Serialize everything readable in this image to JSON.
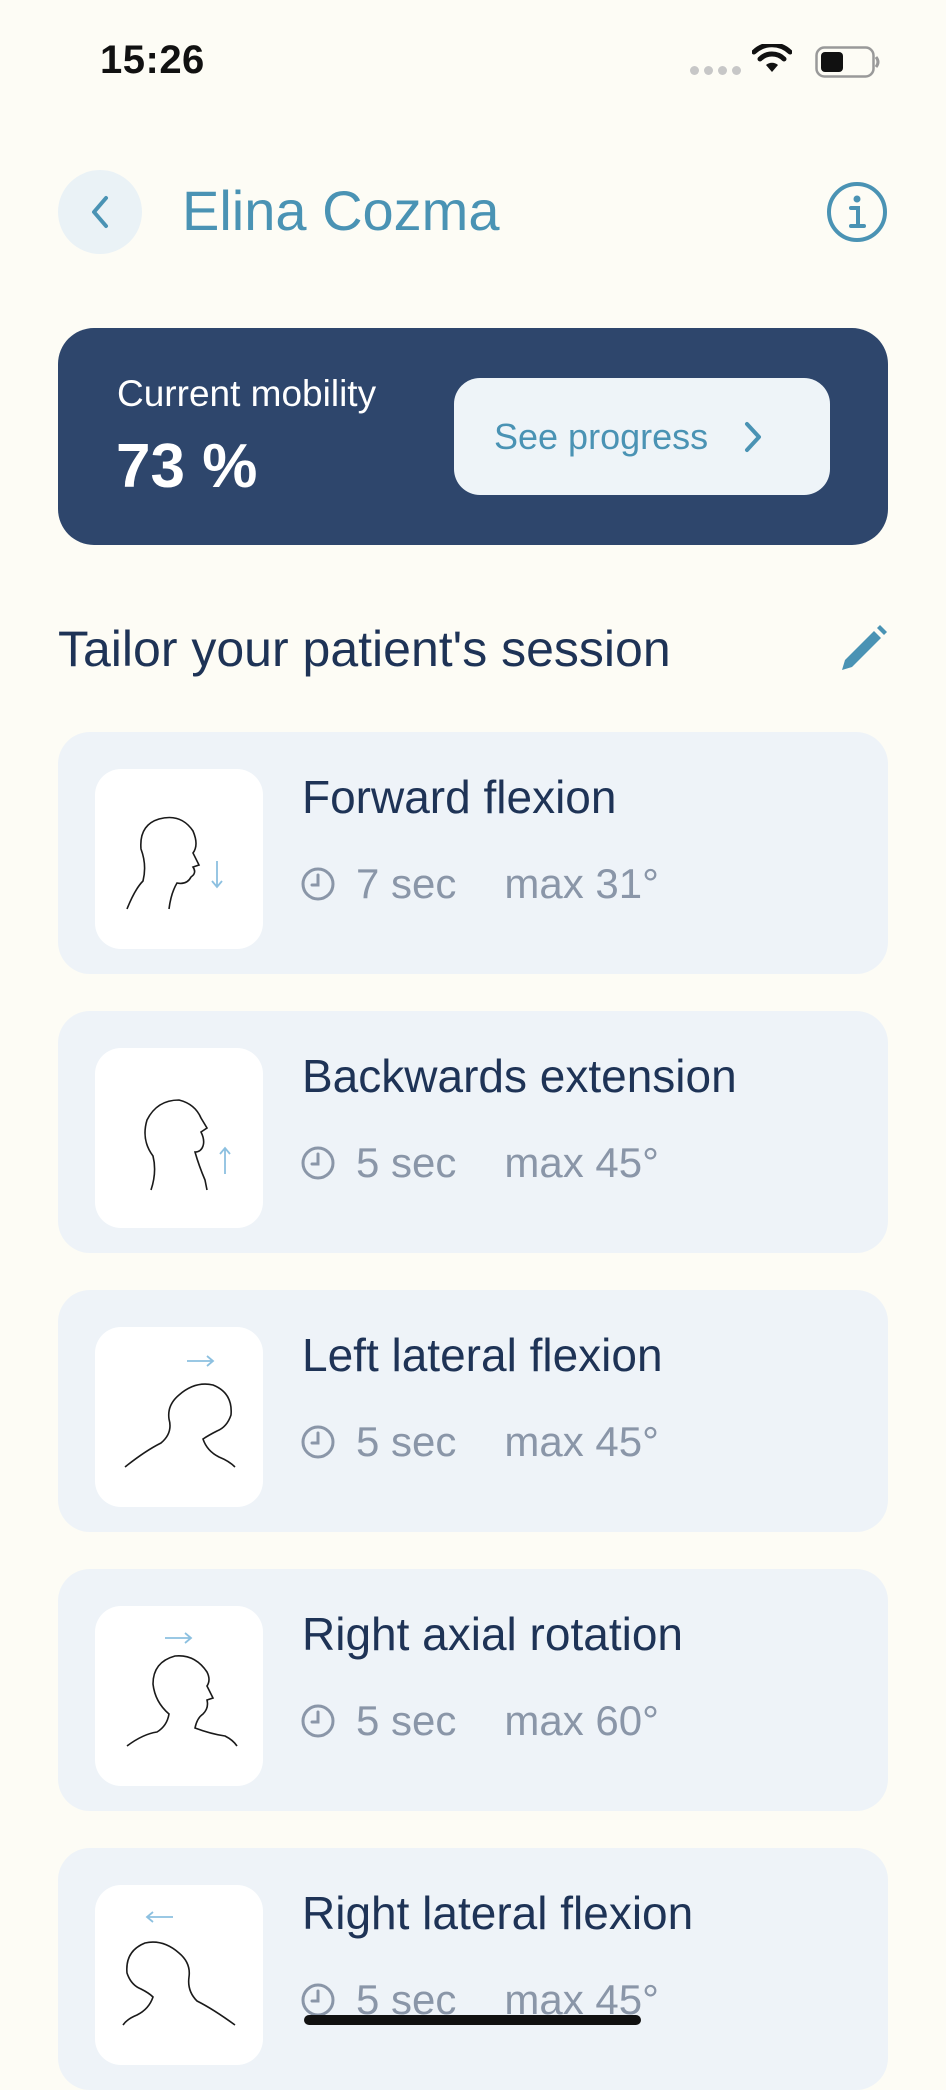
{
  "status_bar": {
    "time": "15:26"
  },
  "header": {
    "title": "Elina Cozma",
    "back_icon": "chevron-left-icon",
    "info_icon": "info-circle-icon"
  },
  "mobility": {
    "label": "Current mobility",
    "value": "73 %",
    "progress_button_label": "See progress"
  },
  "session": {
    "title": "Tailor your patient's session",
    "edit_icon": "pencil-icon"
  },
  "exercises": [
    {
      "name": "Forward flexion",
      "duration": "7 sec",
      "max": "max 31°"
    },
    {
      "name": "Backwards extension",
      "duration": "5 sec",
      "max": "max 45°"
    },
    {
      "name": "Left lateral flexion",
      "duration": "5 sec",
      "max": "max 45°"
    },
    {
      "name": "Right axial rotation",
      "duration": "5 sec",
      "max": "max 60°"
    },
    {
      "name": "Right lateral flexion",
      "duration": "5 sec",
      "max": "max 45°"
    }
  ],
  "colors": {
    "background": "#fdfcf5",
    "accent": "#4a93b4",
    "card_dark": "#2e466c",
    "card_light": "#eef3f8",
    "text_dark": "#1e3356",
    "text_muted": "#8a96a8"
  }
}
